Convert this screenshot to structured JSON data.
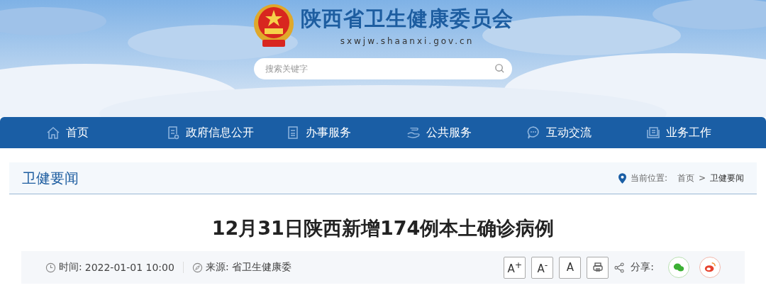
{
  "header": {
    "site_name": "陕西省卫生健康委员会",
    "domain": "sxwjw.shaanxi.gov.cn",
    "search": {
      "placeholder": "搜索关键字"
    }
  },
  "nav": [
    {
      "label": "首页"
    },
    {
      "label": "政府信息公开"
    },
    {
      "label": "办事服务"
    },
    {
      "label": "公共服务"
    },
    {
      "label": "互动交流"
    },
    {
      "label": "业务工作"
    }
  ],
  "section": {
    "title": "卫健要闻",
    "breadcrumb_label": "当前位置:",
    "breadcrumb": [
      "首页",
      "卫健要闻"
    ],
    "separator": ">"
  },
  "article": {
    "title": "12月31日陕西新增174例本土确诊病例",
    "time_label": "时间:",
    "time": "2022-01-01 10:00",
    "source_label": "来源:",
    "source": "省卫生健康委",
    "font_buttons": [
      "A$^{+}$",
      "A$^{-}$",
      "A"
    ],
    "share_label": "分享:"
  }
}
